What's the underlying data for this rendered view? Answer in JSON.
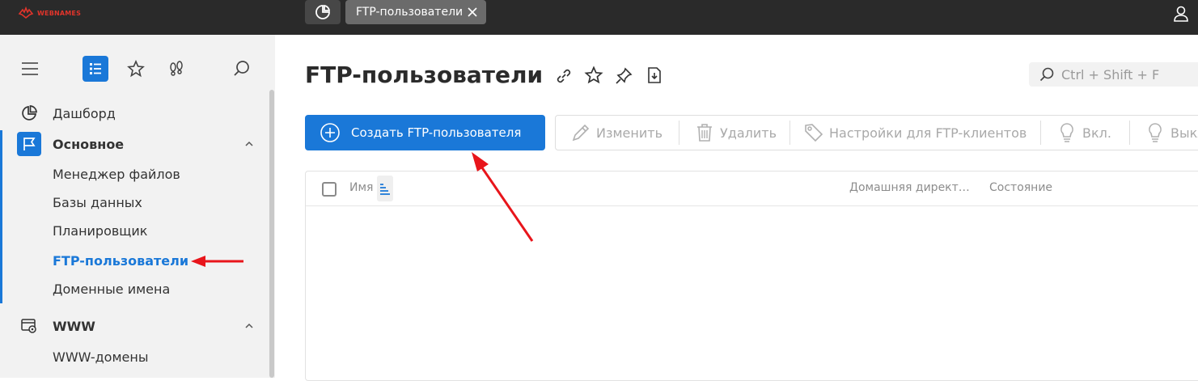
{
  "topbar": {
    "logo_text": "WEBNAMES",
    "active_tab": "FTP-пользователи"
  },
  "sidebar": {
    "items": [
      {
        "label": "Дашборд"
      },
      {
        "label": "Основное"
      },
      {
        "label": "Менеджер файлов"
      },
      {
        "label": "Базы данных"
      },
      {
        "label": "Планировщик"
      },
      {
        "label": "FTP-пользователи"
      },
      {
        "label": "Доменные имена"
      },
      {
        "label": "WWW"
      },
      {
        "label": "WWW-домены"
      }
    ]
  },
  "main": {
    "title": "FTP-пользователи",
    "search_placeholder": "Ctrl + Shift + F",
    "create_button": "Создать FTP-пользователя",
    "toolbar": {
      "edit": "Изменить",
      "delete": "Удалить",
      "client_settings": "Настройки для FTP-клиентов",
      "enable": "Вкл.",
      "disable": "Выкл."
    },
    "table": {
      "columns": [
        "Имя",
        "Домашняя директ…",
        "Состояние"
      ]
    }
  },
  "colors": {
    "accent": "#1a78d8",
    "annotation_arrow": "#e8151b",
    "logo": "#e0342b"
  }
}
